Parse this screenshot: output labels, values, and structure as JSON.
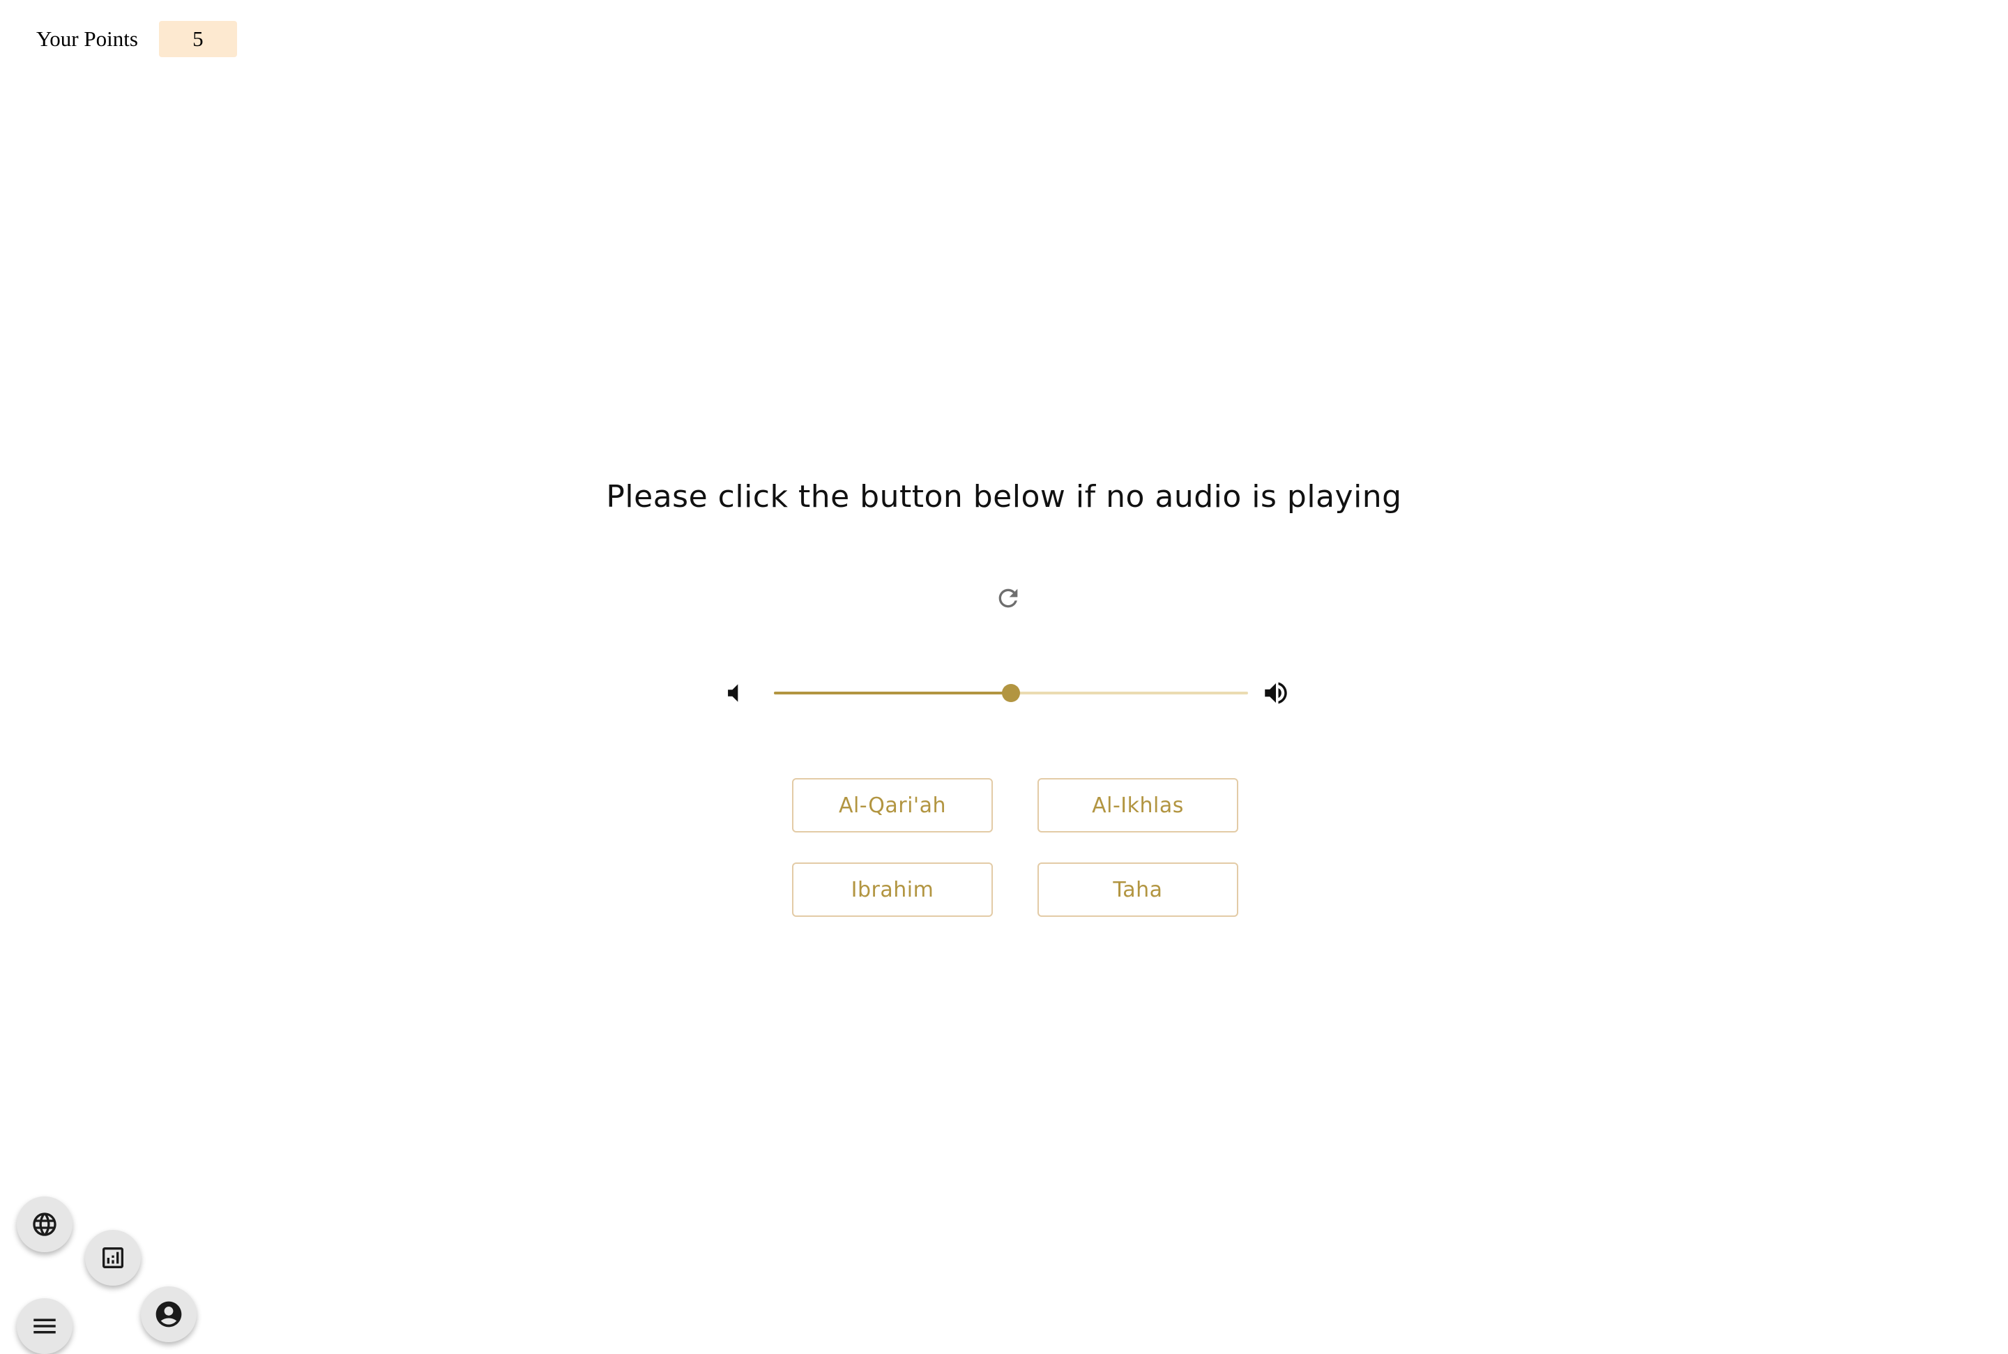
{
  "header": {
    "points_label": "Your Points",
    "points_value": "5"
  },
  "main": {
    "prompt": "Please click the button below if no audio is playing",
    "refresh_icon": "refresh-icon",
    "volume": {
      "level_fraction": 0.5,
      "low_icon": "volume-low-icon",
      "high_icon": "volume-high-icon"
    },
    "answers": [
      {
        "label": "Al-Qari'ah"
      },
      {
        "label": "Al-Ikhlas"
      },
      {
        "label": "Ibrahim"
      },
      {
        "label": "Taha"
      }
    ]
  },
  "fabs": {
    "language_icon": "globe-icon",
    "stats_icon": "bar-chart-icon",
    "menu_icon": "menu-icon",
    "profile_icon": "account-circle-icon"
  },
  "colors": {
    "accent": "#b29541",
    "accent_light": "#ebdcb2",
    "answer_border": "#e3cba6",
    "points_badge": "#fde9d0",
    "fab_bg": "#e6e6e6"
  }
}
